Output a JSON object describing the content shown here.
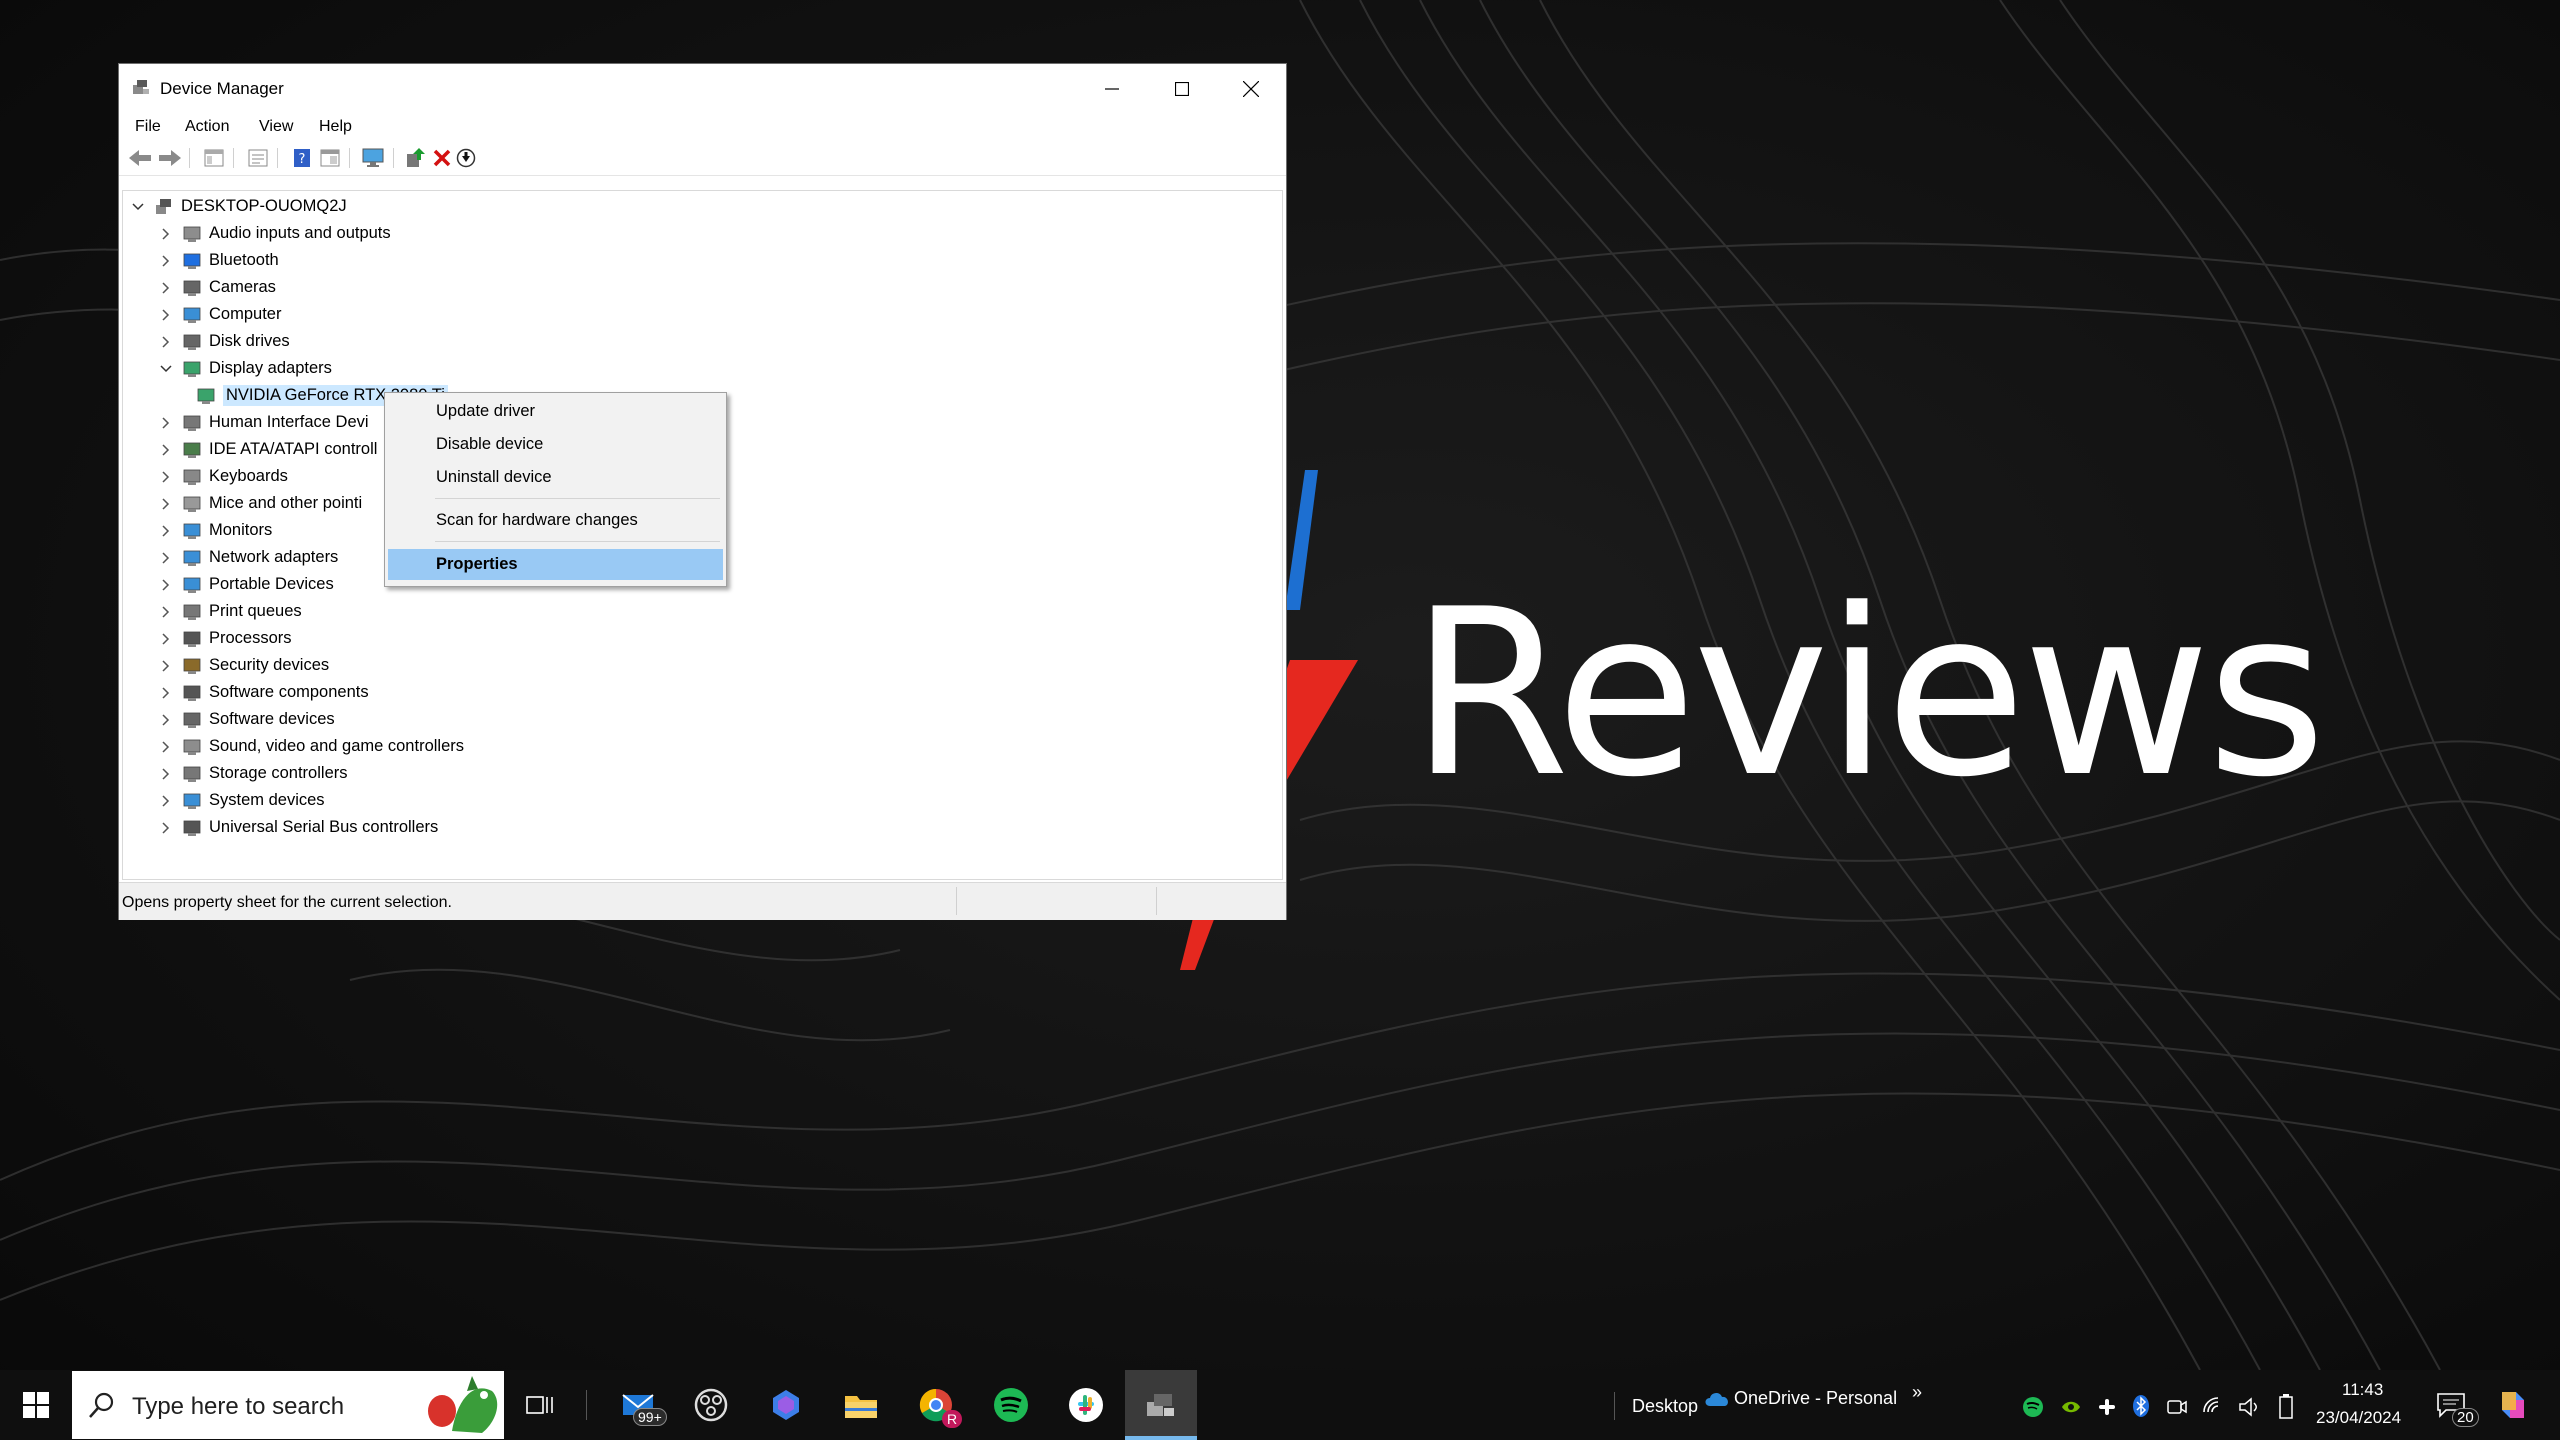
{
  "window": {
    "title": "Device Manager",
    "menu": [
      "File",
      "Action",
      "View",
      "Help"
    ],
    "toolbar_icons": [
      "back-icon",
      "forward-icon",
      "show-hide-tree-icon",
      "properties-icon",
      "help-icon",
      "view-icon",
      "monitor-icon",
      "update-driver-icon",
      "uninstall-icon",
      "download-icon"
    ],
    "tree": {
      "root": "DESKTOP-OUOMQ2J",
      "items": [
        {
          "label": "Audio inputs and outputs",
          "icon": "speaker-icon",
          "expanded": false
        },
        {
          "label": "Bluetooth",
          "icon": "bluetooth-icon",
          "expanded": false
        },
        {
          "label": "Cameras",
          "icon": "camera-icon",
          "expanded": false
        },
        {
          "label": "Computer",
          "icon": "computer-icon",
          "expanded": false
        },
        {
          "label": "Disk drives",
          "icon": "disk-icon",
          "expanded": false
        },
        {
          "label": "Display adapters",
          "icon": "display-adapter-icon",
          "expanded": true
        },
        {
          "label": "NVIDIA GeForce RTX 2080 Ti",
          "icon": "display-adapter-icon",
          "child": true,
          "selected": true
        },
        {
          "label": "Human Interface Devi",
          "icon": "hid-icon",
          "expanded": false
        },
        {
          "label": "IDE ATA/ATAPI controll",
          "icon": "ide-icon",
          "expanded": false
        },
        {
          "label": "Keyboards",
          "icon": "keyboard-icon",
          "expanded": false
        },
        {
          "label": "Mice and other pointi",
          "icon": "mouse-icon",
          "expanded": false
        },
        {
          "label": "Monitors",
          "icon": "monitor-icon",
          "expanded": false
        },
        {
          "label": "Network adapters",
          "icon": "network-icon",
          "expanded": false
        },
        {
          "label": "Portable Devices",
          "icon": "portable-device-icon",
          "expanded": false
        },
        {
          "label": "Print queues",
          "icon": "printer-icon",
          "expanded": false
        },
        {
          "label": "Processors",
          "icon": "processor-icon",
          "expanded": false
        },
        {
          "label": "Security devices",
          "icon": "security-icon",
          "expanded": false
        },
        {
          "label": "Software components",
          "icon": "software-component-icon",
          "expanded": false
        },
        {
          "label": "Software devices",
          "icon": "software-device-icon",
          "expanded": false
        },
        {
          "label": "Sound, video and game controllers",
          "icon": "speaker-icon",
          "expanded": false
        },
        {
          "label": "Storage controllers",
          "icon": "storage-icon",
          "expanded": false
        },
        {
          "label": "System devices",
          "icon": "system-icon",
          "expanded": false
        },
        {
          "label": "Universal Serial Bus controllers",
          "icon": "usb-icon",
          "expanded": false
        }
      ]
    },
    "status": "Opens property sheet for the current selection."
  },
  "context_menu": {
    "items": [
      "Update driver",
      "Disable device",
      "Uninstall device",
      "Scan for hardware changes",
      "Properties"
    ],
    "highlighted": "Properties"
  },
  "wallpaper": {
    "brand_text": "Reviews",
    "accent_red": "#e5281f",
    "accent_blue": "#1d6fd1"
  },
  "taskbar": {
    "search_placeholder": "Type here to search",
    "mail_badge": "99+",
    "chrome_badge": "R",
    "desktop_label": "Desktop",
    "onedrive_label": "OneDrive - Personal",
    "time": "11:43",
    "date": "23/04/2024",
    "notification_count": "20"
  }
}
